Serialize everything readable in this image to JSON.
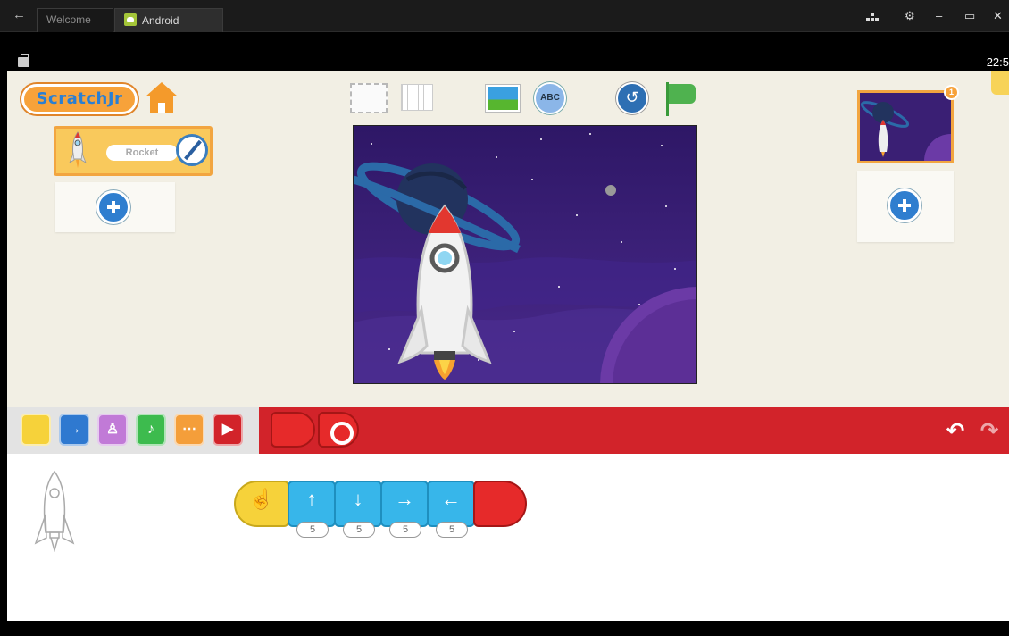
{
  "host": {
    "back_glyph": "←",
    "tabs": [
      {
        "label": "Welcome"
      },
      {
        "label": "Android"
      }
    ],
    "controls": {
      "settings": "⚙",
      "minimize": "–",
      "restore": "▭",
      "close": "✕"
    }
  },
  "statusbar": {
    "time": "22:5"
  },
  "app": {
    "logo": "ScratchJr",
    "sprite": {
      "name": "Rocket"
    },
    "pages": {
      "badge": "1"
    },
    "toolbar": {
      "text_glyph": "ABC",
      "reset_glyph": "↺"
    },
    "palette": {
      "categories": [
        {
          "name": "triggering",
          "color": "#f6d23a",
          "glyph": ""
        },
        {
          "name": "motion",
          "color": "#2f79d0",
          "glyph": "→"
        },
        {
          "name": "looks",
          "color": "#c17ad7",
          "glyph": "♙"
        },
        {
          "name": "sound",
          "color": "#3dbb4e",
          "glyph": "♪"
        },
        {
          "name": "control",
          "color": "#f49e3a",
          "glyph": "⋯"
        },
        {
          "name": "end",
          "color": "#d2232a",
          "glyph": "▶"
        }
      ],
      "undo_glyph": "↶",
      "redo_glyph": "↷"
    },
    "script": {
      "blocks": [
        {
          "type": "start-on-tap",
          "glyph": "☝"
        },
        {
          "type": "move-up",
          "glyph": "↑",
          "param": "5"
        },
        {
          "type": "move-down",
          "glyph": "↓",
          "param": "5"
        },
        {
          "type": "move-right",
          "glyph": "→",
          "param": "5"
        },
        {
          "type": "move-left",
          "glyph": "←",
          "param": "5"
        },
        {
          "type": "end",
          "glyph": ""
        }
      ]
    }
  }
}
